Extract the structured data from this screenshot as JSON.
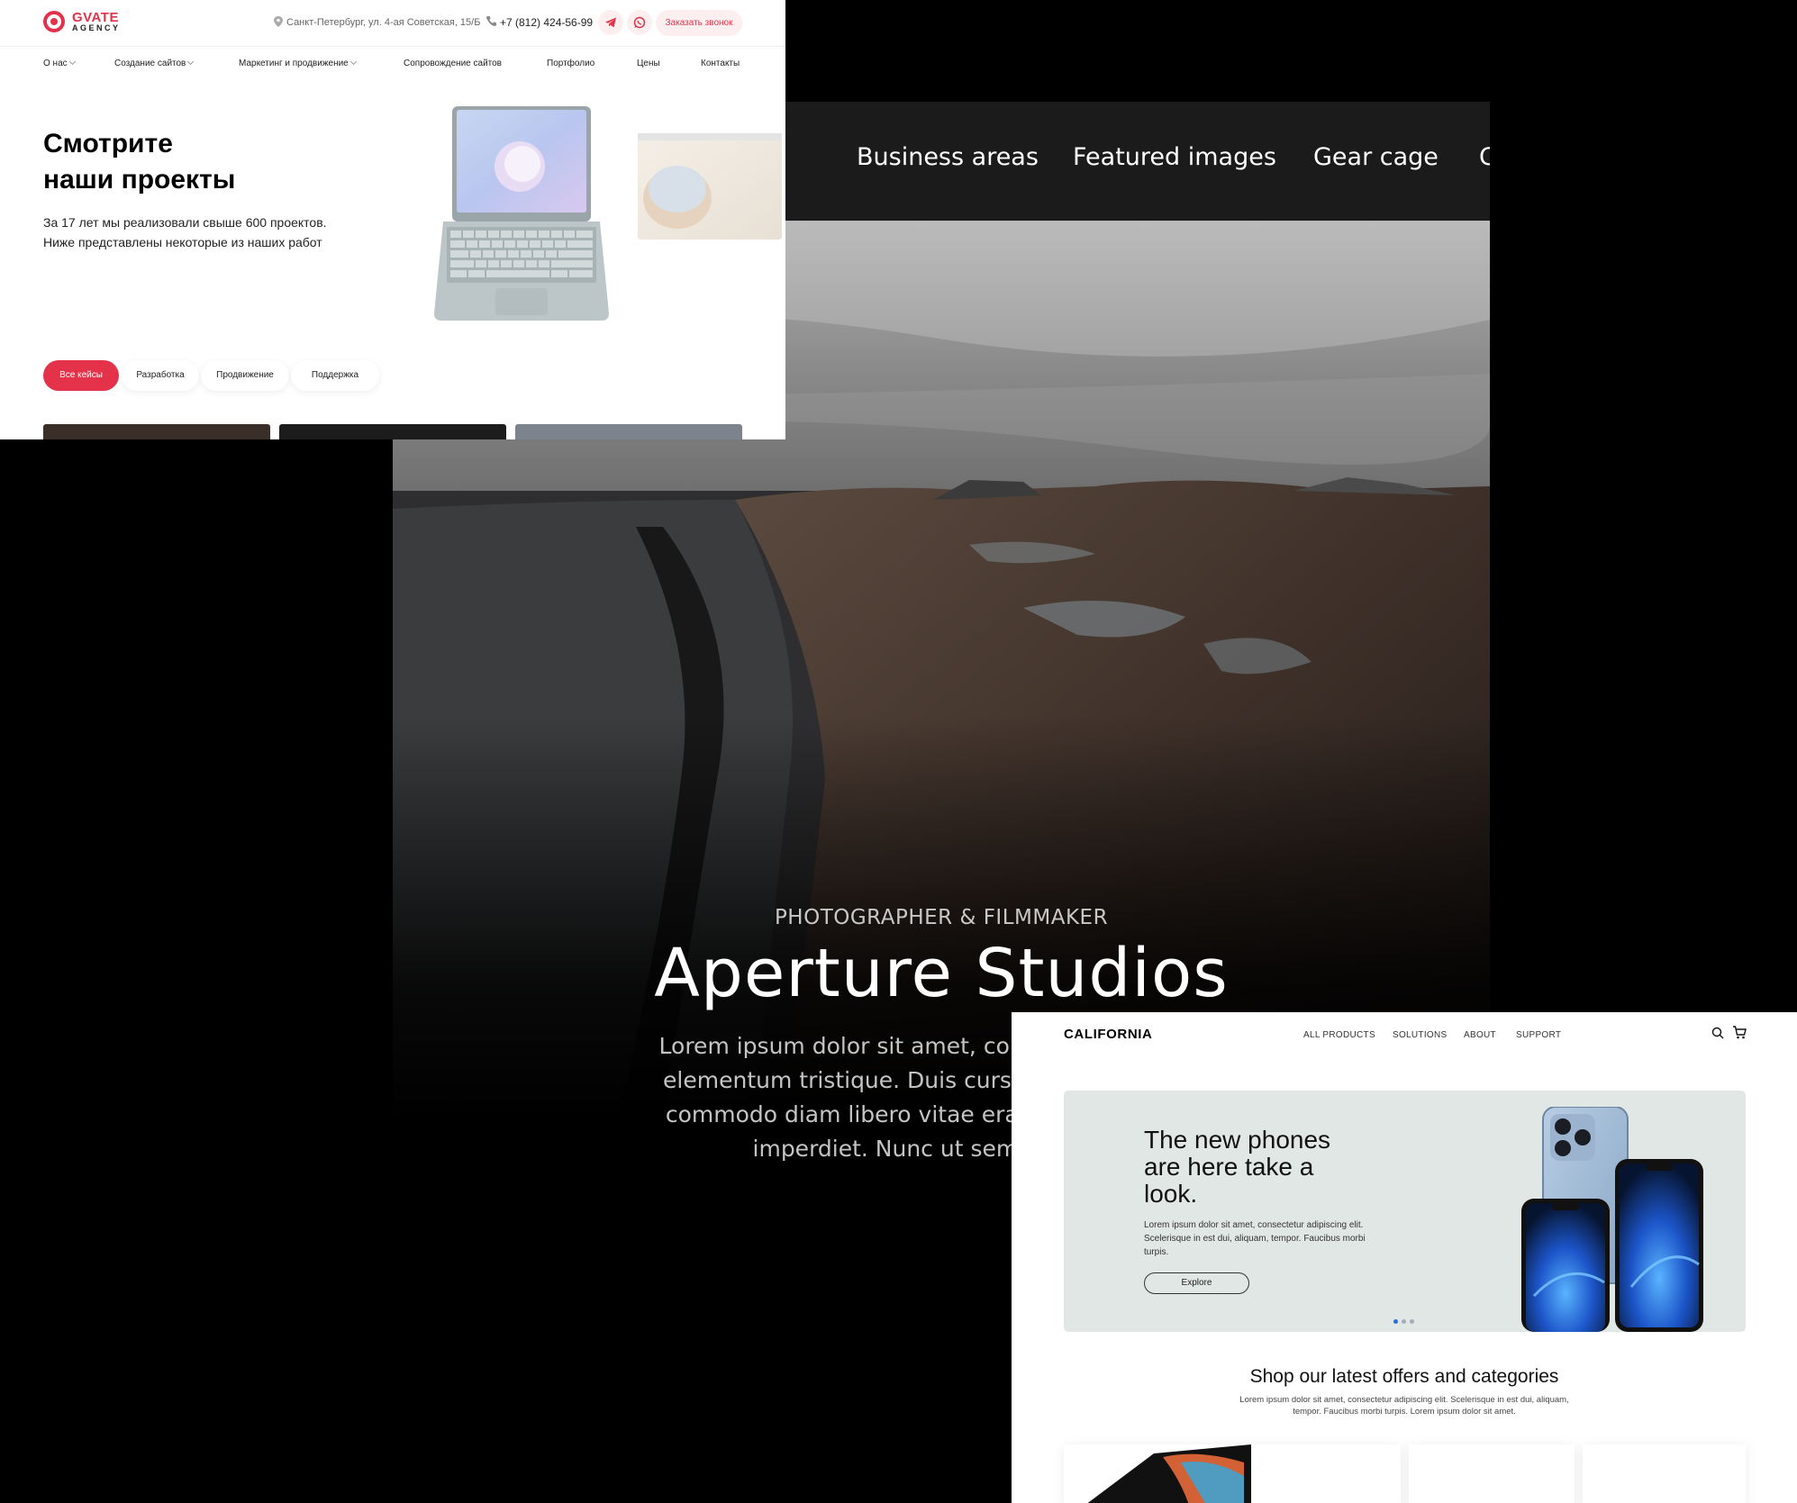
{
  "aperture": {
    "nav": [
      "Business areas",
      "Featured images",
      "Gear cage",
      "C"
    ],
    "subtitle": "PHOTOGRAPHER & FILMMAKER",
    "title": "Aperture Studios",
    "body_lines": [
      "Lorem ipsum dolor sit amet, consectetur adipiscin",
      "elementum tristique. Duis cursus, mi quis viverra",
      "commodo diam libero vitae erat. Aenean faucibu",
      "imperdiet. Nunc ut sem vitae risu"
    ]
  },
  "gvate": {
    "brand": "GVATE",
    "brand_sub": "AGENCY",
    "address": "Санкт-Петербург, ул. 4-ая Советская, 15/Б",
    "phone": "+7 (812) 424-56-99",
    "callback_button": "Заказать звонок",
    "menu": [
      {
        "label": "О нас",
        "has_dropdown": true
      },
      {
        "label": "Создание сайтов",
        "has_dropdown": true
      },
      {
        "label": "Маркетинг и продвижение",
        "has_dropdown": true
      },
      {
        "label": "Сопровождение сайтов",
        "has_dropdown": false
      },
      {
        "label": "Портфолио",
        "has_dropdown": false
      },
      {
        "label": "Цены",
        "has_dropdown": false
      },
      {
        "label": "Контакты",
        "has_dropdown": false
      }
    ],
    "title_lines": [
      "Смотрите",
      "наши проекты"
    ],
    "desc_lines": [
      "За 17 лет мы реализовали свыше 600 проектов.",
      "Ниже представлены некоторые из наших работ"
    ],
    "tabs": [
      "Все кейсы",
      "Разработка",
      "Продвижение",
      "Поддержка"
    ],
    "active_tab": "Все кейсы",
    "accent_color": "#e3324a"
  },
  "california": {
    "logo": "CALIFORNIA",
    "nav": [
      "ALL PRODUCTS",
      "SOLUTIONS",
      "ABOUT",
      "SUPPORT"
    ],
    "hero_title_lines": [
      "The new phones",
      "are here take a",
      "look."
    ],
    "hero_text_lines": [
      "Lorem ipsum dolor sit amet, consectetur adipiscing elit.",
      "Scelerisque in est dui, aliquam, tempor. Faucibus morbi",
      "turpis."
    ],
    "explore_button": "Explore",
    "carousel": {
      "slides": 3,
      "active": 1
    },
    "section_title": "Shop our latest offers and categories",
    "section_text_lines": [
      "Lorem ipsum dolor sit amet, consectetur adipiscing elit. Scelerisque in est dui, aliquam,",
      "tempor. Faucibus morbi turpis. Lorem ipsum dolor sit amet."
    ],
    "icons": [
      "search-icon",
      "cart-icon"
    ]
  }
}
